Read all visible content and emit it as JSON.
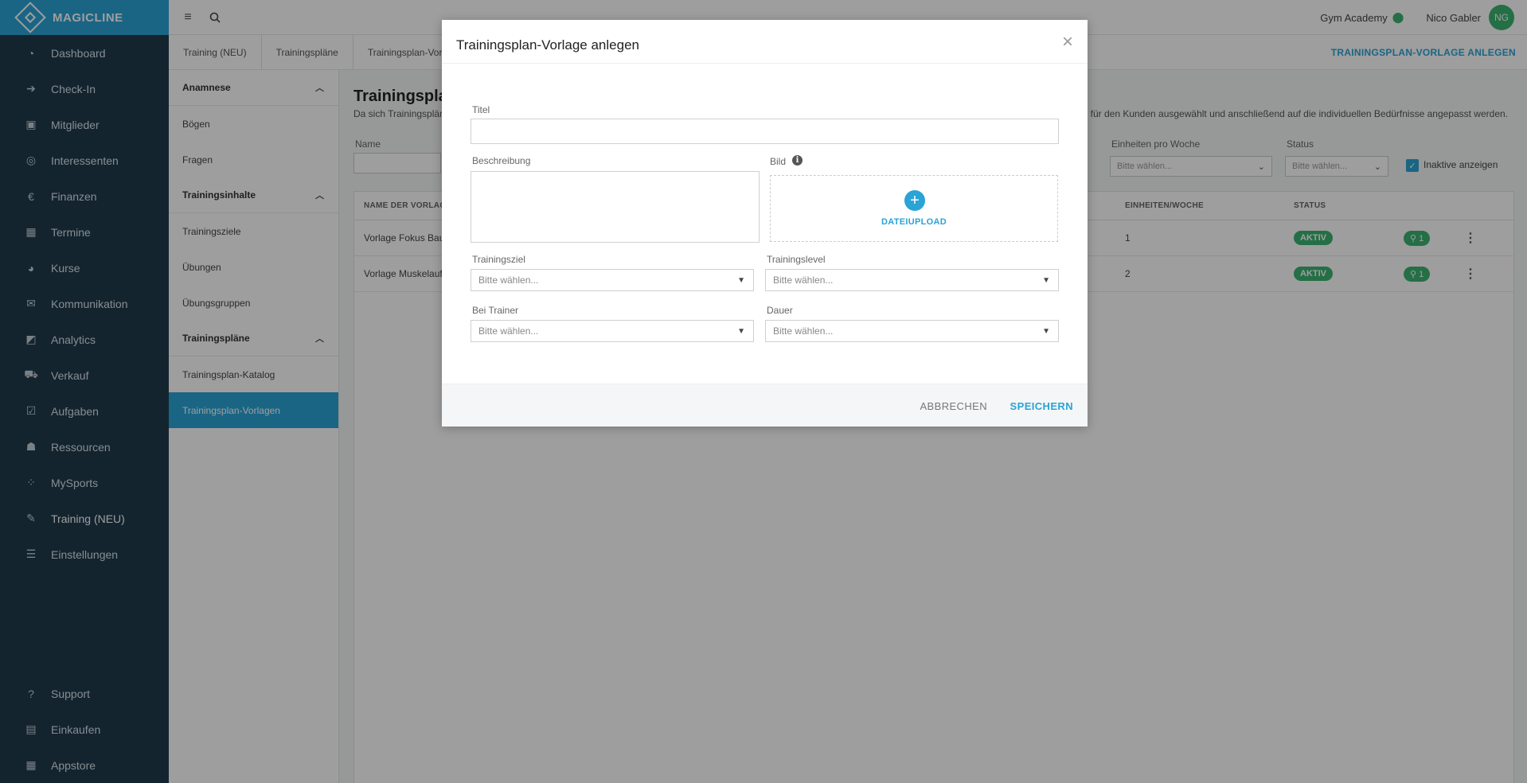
{
  "brand": {
    "name": "MAGICLINE"
  },
  "sidebar": {
    "items": [
      {
        "label": "Dashboard",
        "icon": "dashboard-icon",
        "glyph": "◔"
      },
      {
        "label": "Check-In",
        "icon": "check-in-icon",
        "glyph": "➔"
      },
      {
        "label": "Mitglieder",
        "icon": "members-icon",
        "glyph": "▣"
      },
      {
        "label": "Interessenten",
        "icon": "prospects-icon",
        "glyph": "◎"
      },
      {
        "label": "Finanzen",
        "icon": "finance-icon",
        "glyph": "€"
      },
      {
        "label": "Termine",
        "icon": "calendar-icon",
        "glyph": "▦"
      },
      {
        "label": "Kurse",
        "icon": "courses-icon",
        "glyph": "◕"
      },
      {
        "label": "Kommunikation",
        "icon": "chat-icon",
        "glyph": "✉"
      },
      {
        "label": "Analytics",
        "icon": "analytics-icon",
        "glyph": "◩"
      },
      {
        "label": "Verkauf",
        "icon": "cart-icon",
        "glyph": "⛟"
      },
      {
        "label": "Aufgaben",
        "icon": "tasks-icon",
        "glyph": "☑"
      },
      {
        "label": "Ressourcen",
        "icon": "resources-icon",
        "glyph": "☗"
      },
      {
        "label": "MySports",
        "icon": "mysports-icon",
        "glyph": "⁘"
      },
      {
        "label": "Training (NEU)",
        "icon": "dumbbell-icon",
        "glyph": "✎"
      },
      {
        "label": "Einstellungen",
        "icon": "settings-icon",
        "glyph": "☰"
      }
    ],
    "bottom": [
      {
        "label": "Support",
        "icon": "support-icon",
        "glyph": "?"
      },
      {
        "label": "Einkaufen",
        "icon": "shop-icon",
        "glyph": "▤"
      },
      {
        "label": "Appstore",
        "icon": "appstore-icon",
        "glyph": "▦"
      }
    ]
  },
  "topbar": {
    "studio": "Gym Academy",
    "user": "Nico Gabler",
    "initials": "NG"
  },
  "breadcrumbs": [
    "Training (NEU)",
    "Trainingspläne",
    "Trainingsplan-Vorla"
  ],
  "header_action": "TRAININGSPLAN-VORLAGE ANLEGEN",
  "subnav": {
    "group1": "Anamnese",
    "group1_items": [
      "Bögen",
      "Fragen"
    ],
    "group2": "Trainingsinhalte",
    "group2_items": [
      "Trainingsziele",
      "Übungen",
      "Übungsgruppen"
    ],
    "group3": "Trainingspläne",
    "group3_items": [
      "Trainingsplan-Katalog",
      "Trainingsplan-Vorlagen"
    ]
  },
  "main": {
    "title": "Trainingsplan",
    "desc_left": "Da sich Trainingsplän",
    "desc_right": "ıs für den Kunden ausgewählt und anschließend auf die individuellen Bedürfnisse angepasst werden.",
    "filters": {
      "name_label": "Name",
      "per_week_label": "Einheiten pro Woche",
      "per_week_placeholder": "Bitte wählen...",
      "status_label": "Status",
      "status_placeholder": "Bitte wählen...",
      "inactive_label": "Inaktive anzeigen"
    },
    "table": {
      "col_name": "NAME DER VORLAGE",
      "col_per_week": "EINHEITEN/WOCHE",
      "col_status": "STATUS",
      "rows": [
        {
          "name": "Vorlage Fokus Bau",
          "per_week": "1",
          "status": "AKTIV",
          "locations": "1"
        },
        {
          "name": "Vorlage Muskelauf",
          "per_week": "2",
          "status": "AKTIV",
          "locations": "1"
        }
      ]
    }
  },
  "modal": {
    "title": "Trainingsplan-Vorlage anlegen",
    "close": "×",
    "title_label": "Titel",
    "title_value": "",
    "desc_label": "Beschreibung",
    "image_label": "Bild",
    "upload_label": "DATEIUPLOAD",
    "goal_label": "Trainingsziel",
    "goal_placeholder": "Bitte wählen...",
    "level_label": "Trainingslevel",
    "level_placeholder": "Bitte wählen...",
    "trainer_label": "Bei Trainer",
    "trainer_placeholder": "Bitte wählen...",
    "duration_label": "Dauer",
    "duration_placeholder": "Bitte wählen...",
    "cancel": "ABBRECHEN",
    "save": "SPEICHERN"
  }
}
